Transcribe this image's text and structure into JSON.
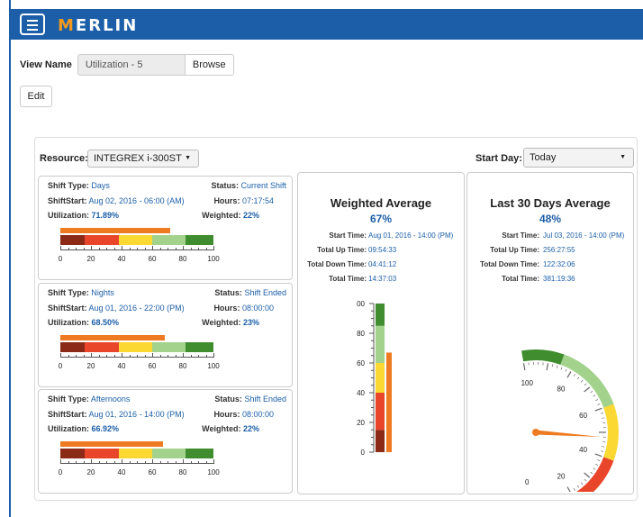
{
  "app": {
    "name": "MERLIN"
  },
  "view": {
    "label": "View Name",
    "value": "Utilization - 5",
    "browse_label": "Browse",
    "edit_label": "Edit"
  },
  "resource": {
    "label": "Resource:",
    "value": "INTEGREX i-300ST"
  },
  "start_day": {
    "label": "Start Day:",
    "value": "Today"
  },
  "labels": {
    "shift_type": "Shift Type:",
    "shift_start": "ShiftStart:",
    "utilization": "Utilization:",
    "status": "Status:",
    "hours": "Hours:",
    "weighted": "Weighted:",
    "start_time": "Start Time:",
    "total_up": "Total Up Time:",
    "total_down": "Total Down Time:",
    "total_time": "Total Time:"
  },
  "shifts": [
    {
      "type": "Days",
      "start": "Aug 02, 2016 - 06:00 (AM)",
      "utilization": "71.89%",
      "status": "Current Shift",
      "hours": "07:17:54",
      "weighted": "22%",
      "fill": 71.89
    },
    {
      "type": "Nights",
      "start": "Aug 01, 2016 - 22:00 (PM)",
      "utilization": "68.50%",
      "status": "Shift Ended",
      "hours": "08:00:00",
      "weighted": "23%",
      "fill": 68.5
    },
    {
      "type": "Afternoons",
      "start": "Aug 01, 2016 - 14:00 (PM)",
      "utilization": "66.92%",
      "status": "Shift Ended",
      "hours": "08:00:00",
      "weighted": "22%",
      "fill": 66.92
    }
  ],
  "bar_ticks": [
    "0",
    "20",
    "40",
    "60",
    "80",
    "100"
  ],
  "weighted_avg": {
    "title": "Weighted Average",
    "pct": "67%",
    "value": 67,
    "start": "Aug 01, 2016 - 14:00 (PM)",
    "up": "09:54:33",
    "down": "04:41:12",
    "total": "14:37:03",
    "ticks": [
      "0",
      "20",
      "40",
      "60",
      "80",
      "00"
    ]
  },
  "last30": {
    "title": "Last 30 Days Average",
    "pct": "48%",
    "value": 48,
    "start": "Jul 03, 2016 - 14:00 (PM)",
    "up": "256:27:55",
    "down": "122:32:06",
    "total": "381:19:36",
    "ticks": [
      "0",
      "20",
      "40",
      "60",
      "80",
      "100"
    ]
  },
  "colors": {
    "brand": "#1c5fa8",
    "accent": "#f39a1c",
    "fill_bar": "#ee7a22",
    "zones": [
      "#8b2a17",
      "#e8452a",
      "#fbd832",
      "#a3d28d",
      "#3f8d2e"
    ]
  }
}
